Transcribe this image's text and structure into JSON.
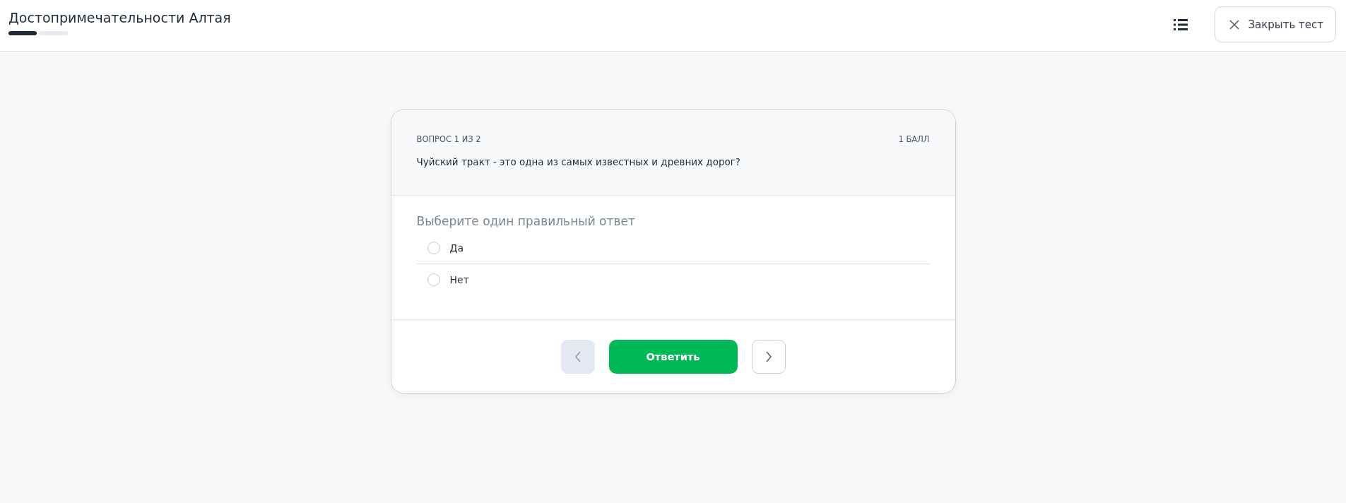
{
  "header": {
    "title": "Достопримечательности Алтая",
    "progress": [
      {
        "done": true
      },
      {
        "done": false
      }
    ],
    "close_button": "Закрыть тест"
  },
  "question": {
    "counter": "ВОПРОС 1 ИЗ 2",
    "points": "1 БАЛЛ",
    "text": "Чуйский тракт - это одна из самых известных и древних дорог?",
    "instruction": "Выберите один правильный ответ",
    "options": [
      {
        "label": "Да",
        "selected": false
      },
      {
        "label": "Нет",
        "selected": false
      }
    ]
  },
  "footer": {
    "prev_disabled": true,
    "answer_button": "Ответить",
    "next_disabled": false
  }
}
